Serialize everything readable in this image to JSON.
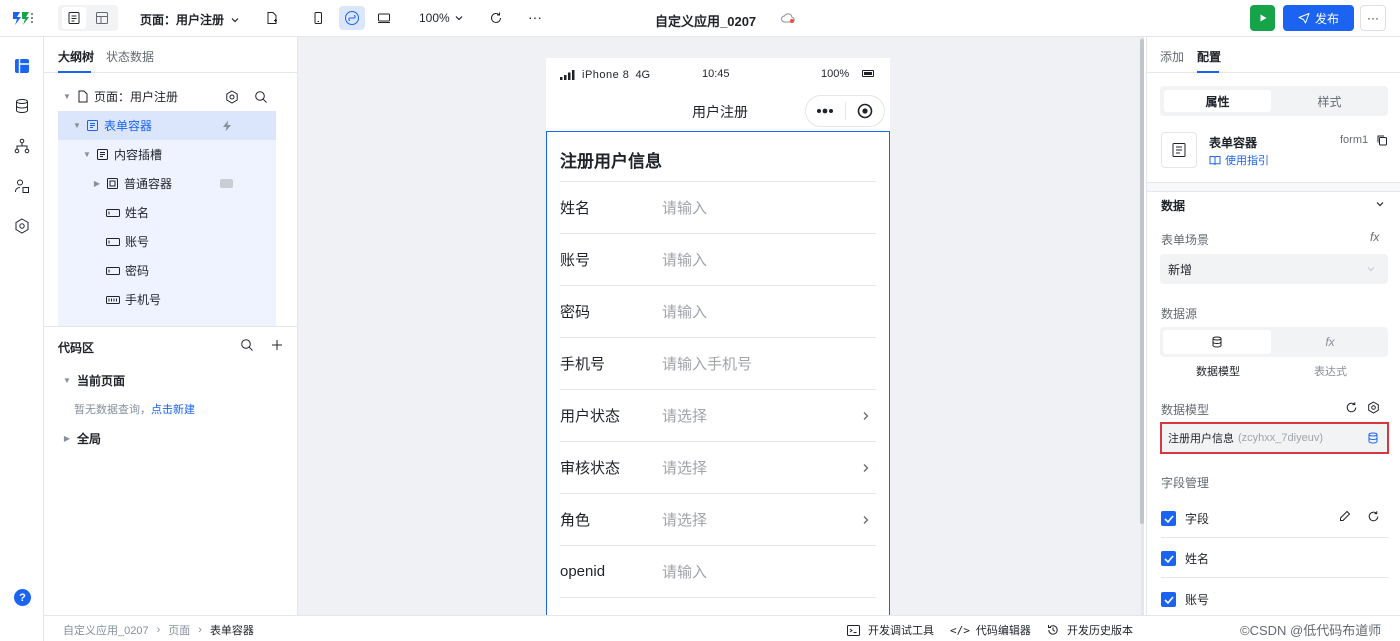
{
  "topbar": {
    "page_label": "页面：用户注册",
    "zoom": "100%",
    "app_title": "自定义应用_0207",
    "publish_label": "发布",
    "more": "···"
  },
  "left": {
    "tabs": [
      "大纲树",
      "状态数据"
    ],
    "tree": [
      {
        "label": "页面：用户注册",
        "icon": "page-icon",
        "indent": 0,
        "caret": "▼"
      },
      {
        "label": "表单容器",
        "icon": "form-icon",
        "indent": 1,
        "caret": "▼",
        "selected": true
      },
      {
        "label": "内容插槽",
        "icon": "slot-icon",
        "indent": 2,
        "caret": "▼"
      },
      {
        "label": "普通容器",
        "icon": "container-icon",
        "indent": 3,
        "caret": "▶"
      },
      {
        "label": "姓名",
        "icon": "input-icon",
        "indent": 3,
        "caret": ""
      },
      {
        "label": "账号",
        "icon": "input-icon",
        "indent": 3,
        "caret": ""
      },
      {
        "label": "密码",
        "icon": "input-icon",
        "indent": 3,
        "caret": ""
      },
      {
        "label": "手机号",
        "icon": "phone-input-icon",
        "indent": 3,
        "caret": ""
      }
    ],
    "code_area": "代码区",
    "current_page": "当前页面",
    "no_query": "暂无数据查询，",
    "create_link": "点击新建",
    "global": "全局"
  },
  "phone": {
    "carrier": "iPhone 8",
    "network": "4G",
    "time": "10:45",
    "battery": "100%",
    "nav_title": "用户注册",
    "form_title": "注册用户信息",
    "rows": [
      {
        "label": "姓名",
        "placeholder": "请输入",
        "select": false
      },
      {
        "label": "账号",
        "placeholder": "请输入",
        "select": false
      },
      {
        "label": "密码",
        "placeholder": "请输入",
        "select": false
      },
      {
        "label": "手机号",
        "placeholder": "请输入手机号",
        "select": false
      },
      {
        "label": "用户状态",
        "placeholder": "请选择",
        "select": true
      },
      {
        "label": "审核状态",
        "placeholder": "请选择",
        "select": true
      },
      {
        "label": "角色",
        "placeholder": "请选择",
        "select": true
      },
      {
        "label": "openid",
        "placeholder": "请输入",
        "select": false
      }
    ]
  },
  "right": {
    "tabs": [
      "添加",
      "配置"
    ],
    "seg": [
      "属性",
      "样式"
    ],
    "component_name": "表单容器",
    "component_id": "form1",
    "guide": "使用指引",
    "data_section": "数据",
    "scene_label": "表单场景",
    "scene_value": "新增",
    "source_label": "数据源",
    "source_model": "数据模型",
    "source_expr": "表达式",
    "model_label": "数据模型",
    "model_value": "注册用户信息",
    "model_code": "(zcyhxx_7diyeuv)",
    "field_mgmt": "字段管理",
    "fields": [
      "字段",
      "姓名",
      "账号"
    ],
    "fx": "fx"
  },
  "bottom": {
    "crumbs": [
      "自定义应用_0207",
      "页面",
      "表单容器"
    ],
    "tools": [
      "开发调试工具",
      "代码编辑器",
      "开发历史版本"
    ],
    "watermark": "©CSDN @低代码布道师",
    "help": "?"
  },
  "colors": {
    "primary": "#1b64f2",
    "publish": "#1b64f2",
    "run": "#16a34a",
    "highlight_border": "#d9363e"
  }
}
